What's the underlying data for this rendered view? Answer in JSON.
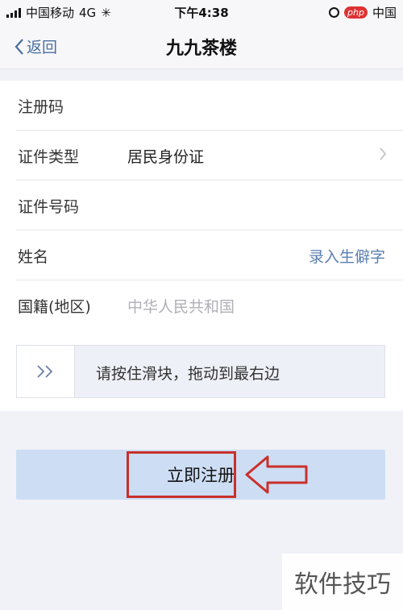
{
  "status_bar": {
    "carrier": "中国移动",
    "network": "4G",
    "time": "下午4:38",
    "badge_text": "php",
    "badge_suffix": "中国"
  },
  "nav": {
    "back_label": "返回",
    "title": "九九茶楼"
  },
  "form": {
    "rows": [
      {
        "label": "注册码",
        "value": ""
      },
      {
        "label": "证件类型",
        "value": "居民身份证"
      },
      {
        "label": "证件号码",
        "value": ""
      },
      {
        "label": "姓名",
        "action": "录入生僻字"
      },
      {
        "label": "国籍(地区)",
        "placeholder": "中华人民共和国"
      }
    ]
  },
  "slider": {
    "text": "请按住滑块，拖动到最右边"
  },
  "register_button": "立即注册",
  "watermark": "软件技巧",
  "colors": {
    "link": "#5b7fb0",
    "button_bg": "#cdddf3",
    "annotation": "#c9302c"
  }
}
